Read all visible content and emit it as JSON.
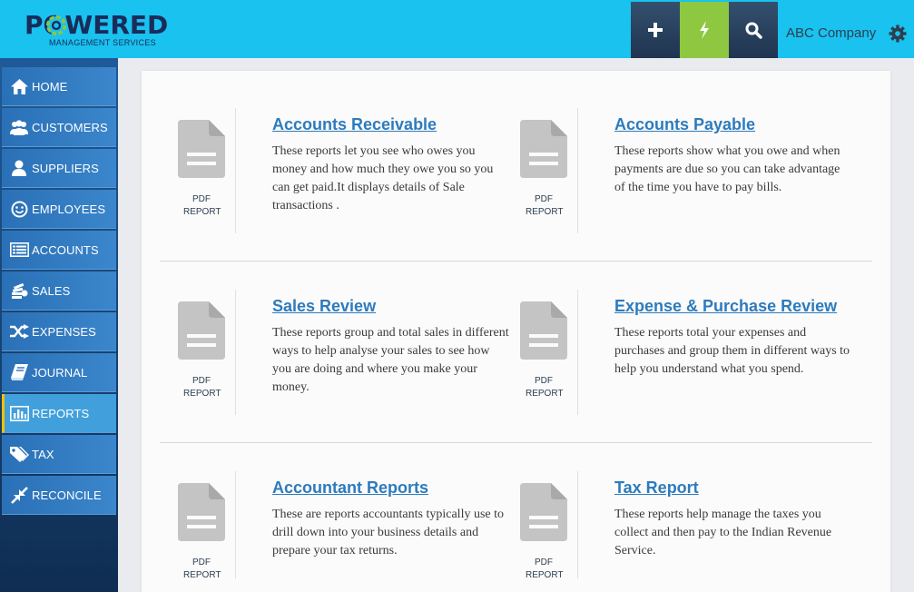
{
  "header": {
    "logo_main": "POWERED",
    "logo_sub": "MANAGEMENT SERVICES",
    "company_name": "ABC Company",
    "buttons": {
      "add_icon": "plus-icon",
      "quick_icon": "bolt-icon",
      "search_icon": "search-icon",
      "settings_icon": "gear-icon"
    },
    "colors": {
      "bar": "#19c2ef",
      "quick": "#8ec740",
      "dark": "#2b4663"
    }
  },
  "sidebar": {
    "items": [
      {
        "label": "HOME",
        "icon": "home-icon"
      },
      {
        "label": "CUSTOMERS",
        "icon": "users-icon"
      },
      {
        "label": "SUPPLIERS",
        "icon": "user-icon"
      },
      {
        "label": "EMPLOYEES",
        "icon": "smile-icon"
      },
      {
        "label": "ACCOUNTS",
        "icon": "list-icon"
      },
      {
        "label": "SALES",
        "icon": "coins-icon"
      },
      {
        "label": "EXPENSES",
        "icon": "shuffle-icon"
      },
      {
        "label": "JOURNAL",
        "icon": "book-icon"
      },
      {
        "label": "REPORTS",
        "icon": "bar-chart-icon",
        "active": true
      },
      {
        "label": "TAX",
        "icon": "tag-icon"
      },
      {
        "label": "RECONCILE",
        "icon": "compress-icon"
      }
    ]
  },
  "reports": [
    {
      "title": "Accounts Receivable",
      "badge_1": "PDF",
      "badge_2": "REPORT",
      "description": "These reports let you see who owes you money and how much they owe you so you can get paid.It displays details of Sale transactions ."
    },
    {
      "title": "Accounts Payable",
      "badge_1": "PDF",
      "badge_2": "REPORT",
      "description": "These reports show what you owe and when payments are due so you can take advantage of the time you have to pay bills."
    },
    {
      "title": "Sales Review",
      "badge_1": "PDF",
      "badge_2": "REPORT",
      "description": "These reports group and total sales in different ways to help analyse your sales to see how you are doing and where you make your money."
    },
    {
      "title": "Expense & Purchase Review",
      "badge_1": "PDF",
      "badge_2": "REPORT",
      "description": "These reports total your expenses and purchases and group them in different ways to help you understand what you spend."
    },
    {
      "title": "Accountant Reports",
      "badge_1": "PDF",
      "badge_2": "REPORT",
      "description": "These are reports accountants typically use to drill down into your business details and prepare your tax returns."
    },
    {
      "title": "Tax Report",
      "badge_1": "PDF",
      "badge_2": "REPORT",
      "description": "These reports help manage the taxes you collect and then pay to the Indian Revenue Service."
    }
  ]
}
